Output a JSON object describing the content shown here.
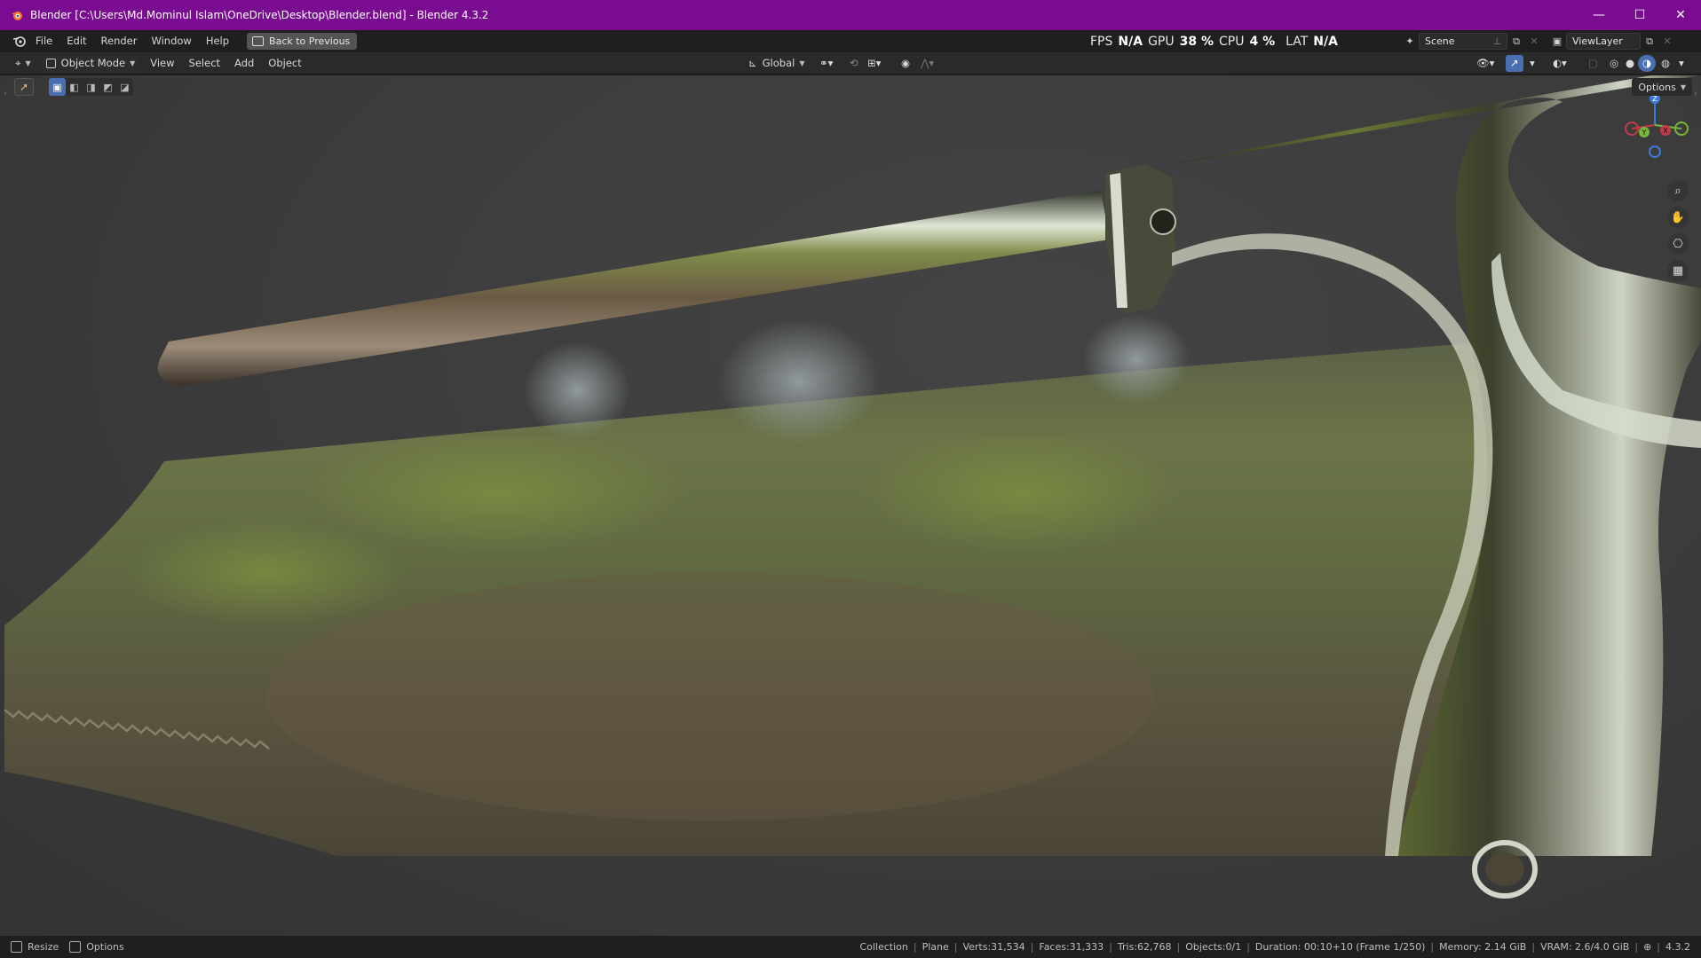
{
  "window": {
    "title": "Blender [C:\\Users\\Md.Mominul Islam\\OneDrive\\Desktop\\Blender.blend] - Blender 4.3.2",
    "minimize": "—",
    "maximize": "☐",
    "close": "✕"
  },
  "menu": {
    "items": [
      "File",
      "Edit",
      "Render",
      "Window",
      "Help"
    ],
    "back_button": "Back to Previous"
  },
  "perf": {
    "fps_label": "FPS",
    "fps_value": "N/A",
    "gpu_label": "GPU",
    "gpu_value": "38 %",
    "cpu_label": "CPU",
    "cpu_value": "4 %",
    "lat_label": "LAT",
    "lat_value": "N/A"
  },
  "scene": {
    "name": "Scene",
    "view_layer": "ViewLayer"
  },
  "viewport_header": {
    "mode": "Object Mode",
    "menus": [
      "View",
      "Select",
      "Add",
      "Object"
    ],
    "transform_orientation": "Global"
  },
  "viewport": {
    "options_label": "Options",
    "axes": {
      "z": "Z",
      "y": "Y",
      "x": "X"
    }
  },
  "status": {
    "left": [
      "Resize",
      "Options"
    ],
    "collection": "Collection",
    "object": "Plane",
    "verts": "Verts:31,534",
    "faces": "Faces:31,333",
    "tris": "Tris:62,768",
    "objects": "Objects:0/1",
    "duration": "Duration: 00:10+10 (Frame 1/250)",
    "memory": "Memory: 2.14 GiB",
    "vram": "VRAM: 2.6/4.0 GiB",
    "version": "4.3.2"
  },
  "colors": {
    "title_bar": "#7a0c92",
    "accent_blue": "#4a6fb0"
  }
}
